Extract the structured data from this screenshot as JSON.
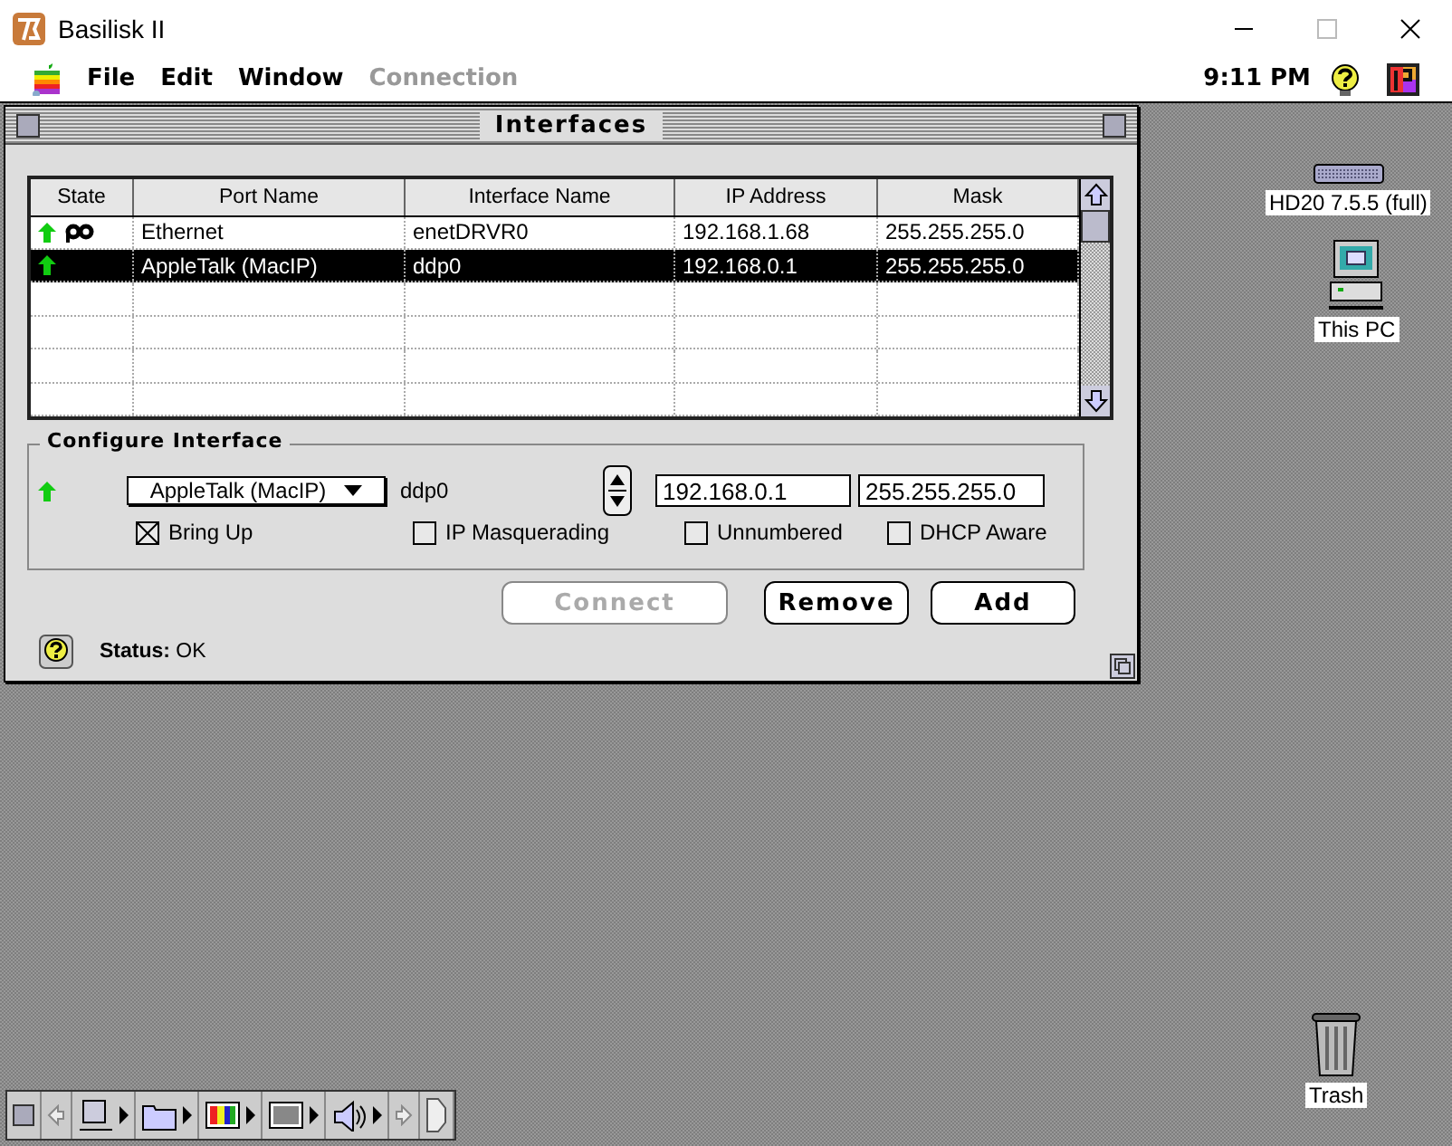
{
  "host_window": {
    "title": "Basilisk II"
  },
  "menu_bar": {
    "items": [
      {
        "label": "File",
        "disabled": false
      },
      {
        "label": "Edit",
        "disabled": false
      },
      {
        "label": "Window",
        "disabled": false
      },
      {
        "label": "Connection",
        "disabled": true
      }
    ],
    "clock": "9:11 PM"
  },
  "dialog": {
    "title": "Interfaces",
    "table": {
      "columns": [
        "State",
        "Port Name",
        "Interface Name",
        "IP Address",
        "Mask"
      ],
      "rows": [
        {
          "up": true,
          "linked": true,
          "port": "Ethernet",
          "interface": "enetDRVR0",
          "ip": "192.168.1.68",
          "mask": "255.255.255.0",
          "selected": false
        },
        {
          "up": true,
          "linked": false,
          "port": "AppleTalk (MacIP)",
          "interface": "ddp0",
          "ip": "192.168.0.1",
          "mask": "255.255.255.0",
          "selected": true
        }
      ]
    },
    "configure": {
      "title": "Configure Interface",
      "up": true,
      "port": "AppleTalk (MacIP)",
      "interface": "ddp0",
      "ip": "192.168.0.1",
      "mask": "255.255.255.0",
      "options": [
        {
          "label": "Bring Up",
          "checked": true
        },
        {
          "label": "IP Masquerading",
          "checked": false
        },
        {
          "label": "Unnumbered",
          "checked": false
        },
        {
          "label": "DHCP Aware",
          "checked": false
        }
      ]
    },
    "buttons": [
      {
        "label": "Connect",
        "disabled": true
      },
      {
        "label": "Remove",
        "disabled": false
      },
      {
        "label": "Add",
        "disabled": false
      }
    ],
    "status": "**Status:** OK"
  },
  "desktop_icons": [
    {
      "label": "HD20 7.5.5 (full)",
      "kind": "disk"
    },
    {
      "label": "This PC",
      "kind": "computer"
    },
    {
      "label": "Trash",
      "kind": "trash"
    }
  ]
}
